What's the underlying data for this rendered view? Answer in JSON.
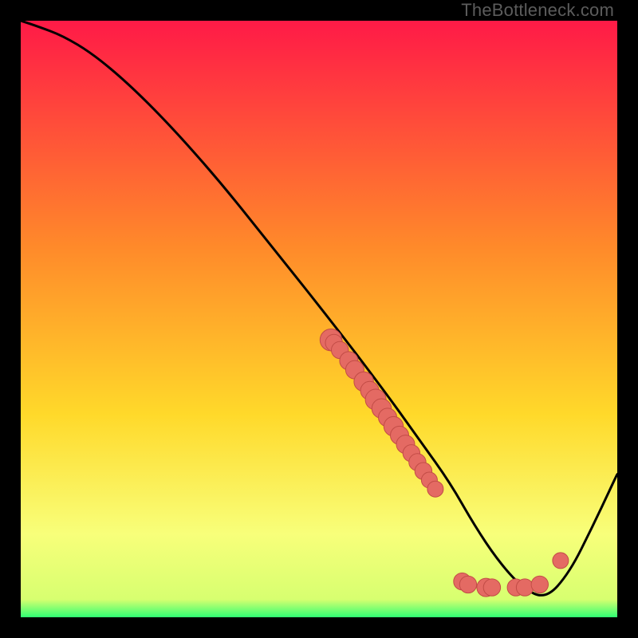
{
  "watermark": "TheBottleneck.com",
  "colors": {
    "gradient_top": "#ff1a47",
    "gradient_mid1": "#ff6a2a",
    "gradient_mid2": "#ffd92a",
    "gradient_mid3": "#f9ff6a",
    "gradient_bottom": "#2fff73",
    "curve": "#000000",
    "dot_fill": "#e46a63",
    "dot_stroke": "#c24c46"
  },
  "chart_data": {
    "type": "line",
    "title": "",
    "xlabel": "",
    "ylabel": "",
    "xlim": [
      0,
      100
    ],
    "ylim": [
      0,
      100
    ],
    "x": [
      0,
      3,
      7,
      12,
      18,
      25,
      33,
      41,
      49,
      56,
      62,
      67,
      72,
      76,
      80,
      84,
      88,
      92,
      96,
      100
    ],
    "values": [
      100,
      99,
      97.5,
      94.5,
      89.5,
      82.5,
      73.5,
      63.5,
      53.5,
      44.5,
      36.5,
      29.5,
      22.5,
      15.5,
      9.5,
      5.0,
      3.0,
      7.5,
      15.5,
      24.0
    ],
    "series": [
      {
        "name": "curve",
        "x": [
          0,
          3,
          7,
          12,
          18,
          25,
          33,
          41,
          49,
          56,
          62,
          67,
          72,
          76,
          80,
          84,
          88,
          92,
          96,
          100
        ],
        "values": [
          100,
          99,
          97.5,
          94.5,
          89.5,
          82.5,
          73.5,
          63.5,
          53.5,
          44.5,
          36.5,
          29.5,
          22.5,
          15.5,
          9.5,
          5.0,
          3.0,
          7.5,
          15.5,
          24.0
        ]
      }
    ],
    "scatter_points": [
      {
        "x": 52,
        "y": 46.5,
        "r": 1.3
      },
      {
        "x": 52.5,
        "y": 46,
        "r": 0.9
      },
      {
        "x": 53.5,
        "y": 44.8,
        "r": 0.9
      },
      {
        "x": 55,
        "y": 43,
        "r": 1.0
      },
      {
        "x": 56,
        "y": 41.5,
        "r": 1.0
      },
      {
        "x": 57.5,
        "y": 39.5,
        "r": 1.1
      },
      {
        "x": 58.5,
        "y": 38,
        "r": 1.0
      },
      {
        "x": 59.5,
        "y": 36.5,
        "r": 1.2
      },
      {
        "x": 60.5,
        "y": 35,
        "r": 1.1
      },
      {
        "x": 61.5,
        "y": 33.5,
        "r": 1.0
      },
      {
        "x": 62.5,
        "y": 32,
        "r": 1.1
      },
      {
        "x": 63.5,
        "y": 30.5,
        "r": 1.0
      },
      {
        "x": 64.5,
        "y": 29,
        "r": 1.0
      },
      {
        "x": 65.5,
        "y": 27.5,
        "r": 0.9
      },
      {
        "x": 66.5,
        "y": 26,
        "r": 0.9
      },
      {
        "x": 67.5,
        "y": 24.5,
        "r": 0.9
      },
      {
        "x": 68.5,
        "y": 23,
        "r": 0.8
      },
      {
        "x": 69.5,
        "y": 21.5,
        "r": 0.8
      },
      {
        "x": 74,
        "y": 6,
        "r": 0.9
      },
      {
        "x": 75,
        "y": 5.5,
        "r": 0.9
      },
      {
        "x": 78,
        "y": 5,
        "r": 1.0
      },
      {
        "x": 79,
        "y": 5,
        "r": 0.9
      },
      {
        "x": 83,
        "y": 5,
        "r": 0.9
      },
      {
        "x": 84.5,
        "y": 5,
        "r": 0.9
      },
      {
        "x": 87,
        "y": 5.5,
        "r": 0.9
      },
      {
        "x": 90.5,
        "y": 9.5,
        "r": 0.8
      }
    ]
  }
}
